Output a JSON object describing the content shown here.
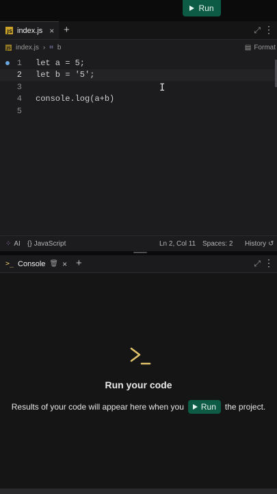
{
  "toolbar": {
    "run_label": "Run"
  },
  "editor": {
    "tab": {
      "filename": "index.js",
      "icon": "js-file-icon",
      "close": "×",
      "add": "+"
    },
    "breadcrumb": {
      "file": "index.js",
      "separator": "›",
      "symbol_icon": "symbol-icon",
      "symbol": "b"
    },
    "format_label": "Format",
    "lines": [
      {
        "num": "1",
        "text": "let a = 5;"
      },
      {
        "num": "2",
        "text": "let b = '5';"
      },
      {
        "num": "3",
        "text": ""
      },
      {
        "num": "4",
        "text": "console.log(a+b)"
      },
      {
        "num": "5",
        "text": ""
      }
    ],
    "active_line": 2
  },
  "statusbar": {
    "ai_label": "AI",
    "language": "JavaScript",
    "position": "Ln 2, Col 11",
    "spaces": "Spaces: 2",
    "history": "History"
  },
  "console": {
    "tab_label": "Console",
    "close": "×",
    "add": "+",
    "empty_title": "Run your code",
    "message_before": "Results of your code will appear here when you",
    "run_label": "Run",
    "message_after": "the project."
  },
  "colors": {
    "run_green": "#0d5b45",
    "prompt_yellow": "#e0c36b"
  }
}
